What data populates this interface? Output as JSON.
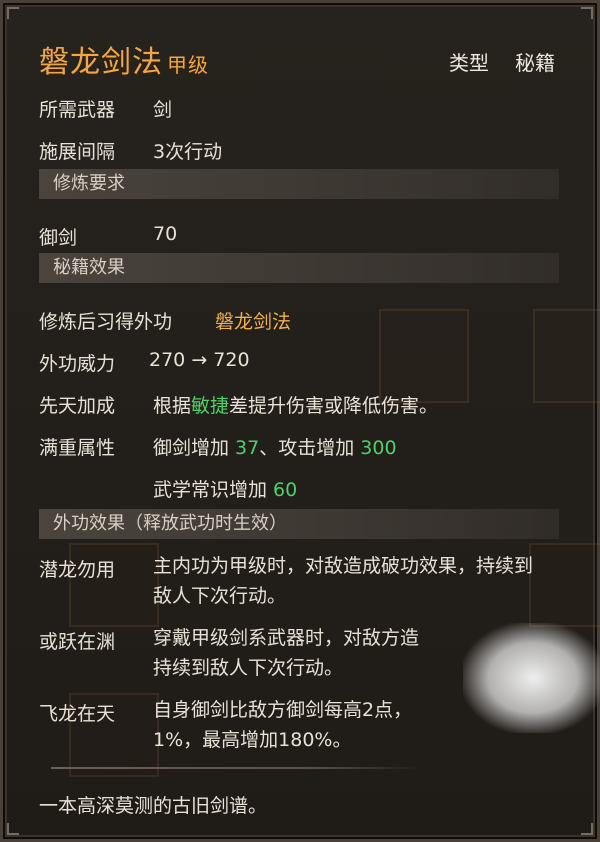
{
  "header": {
    "title": "磐龙剑法",
    "grade": "甲级",
    "type_label": "类型",
    "type_value": "秘籍"
  },
  "basic": {
    "weapon_label": "所需武器",
    "weapon_value": "剑",
    "interval_label": "施展间隔",
    "interval_value": "3次行动"
  },
  "requirements": {
    "section_title": "修炼要求",
    "skill_label": "御剑",
    "skill_value": "70"
  },
  "effects": {
    "section_title": "秘籍效果",
    "learned_label": "修炼后习得外功",
    "learned_value": "磐龙剑法",
    "power_label": "外功威力",
    "power_from": "270",
    "power_arrow": "→",
    "power_to": "720",
    "innate_label": "先天加成",
    "innate_pre": "根据",
    "innate_attr": "敏捷",
    "innate_post": "差提升伤害或降低伤害。",
    "full_label": "满重属性",
    "full_line1_a": "御剑增加 ",
    "full_line1_v1": "37",
    "full_line1_b": "、攻击增加 ",
    "full_line1_v2": "300",
    "full_line2_a": "武学常识增加 ",
    "full_line2_v": "60"
  },
  "skill_effects": {
    "section_title": "外功效果（释放武功时生效）",
    "items": [
      {
        "name": "潜龙勿用",
        "line1": "主内功为甲级时，对敌造成破功效果，持续到",
        "line2": "敌人下次行动。"
      },
      {
        "name": "或跃在渊",
        "line1": "穿戴甲级剑系武器时，对敌方造",
        "line2": "持续到敌人下次行动。"
      },
      {
        "name": "飞龙在天",
        "line1": "自身御剑比敌方御剑每高2点，",
        "line2": "1%，最高增加180%。"
      }
    ]
  },
  "footer": {
    "flavor": "一本高深莫测的古旧剑谱。"
  },
  "colors": {
    "title_gold": "#f0a64a",
    "value_green": "#4fd06a",
    "highlight_gold": "#f0b050"
  }
}
